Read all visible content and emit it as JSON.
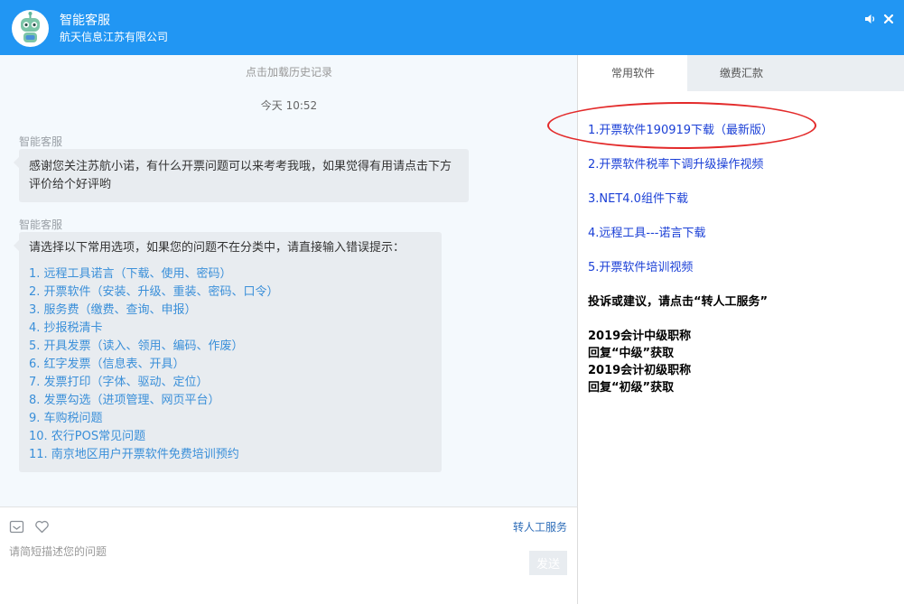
{
  "header": {
    "title": "智能客服",
    "subtitle": "航天信息江苏有限公司"
  },
  "chat": {
    "load_history": "点击加载历史记录",
    "timestamp": "今天 10:52",
    "messages": [
      {
        "sender": "智能客服",
        "text": "感谢您关注苏航小诺，有什么开票问题可以来考考我哦，如果觉得有用请点击下方评价给个好评哟"
      },
      {
        "sender": "智能客服",
        "intro": "请选择以下常用选项，如果您的问题不在分类中，请直接输入错误提示：",
        "options": [
          "1. 远程工具诺言（下载、使用、密码）",
          "2. 开票软件（安装、升级、重装、密码、口令）",
          "3. 服务费（缴费、查询、申报）",
          "4. 抄报税清卡",
          "5. 开具发票（读入、领用、编码、作废）",
          "6. 红字发票（信息表、开具）",
          "7. 发票打印（字体、驱动、定位）",
          "8. 发票勾选（进项管理、网页平台）",
          "9. 车购税问题",
          "10. 农行POS常见问题",
          "11. 南京地区用户开票软件免费培训预约"
        ]
      }
    ]
  },
  "input": {
    "placeholder": "请简短描述您的问题",
    "transfer_label": "转人工服务",
    "send_label": "发送"
  },
  "panel": {
    "tabs": [
      "常用软件",
      "缴费汇款"
    ],
    "links": [
      "1.开票软件190919下载（最新版）",
      "2.开票软件税率下调升级操作视频",
      "3.NET4.0组件下载",
      "4.远程工具---诺言下载",
      "5.开票软件培训视频"
    ],
    "complaint": "投诉或建议，请点击“转人工服务”",
    "notes": [
      "2019会计中级职称",
      "回复“中级”获取",
      "2019会计初级职称",
      "回复“初级”获取"
    ]
  },
  "colors": {
    "header": "#2196f3",
    "chat_bg": "#f4f9fd",
    "bubble": "#e8ecf0",
    "option_link": "#3a8fd9",
    "panel_link": "#1a3fd6",
    "annotation": "#e32a2a"
  }
}
